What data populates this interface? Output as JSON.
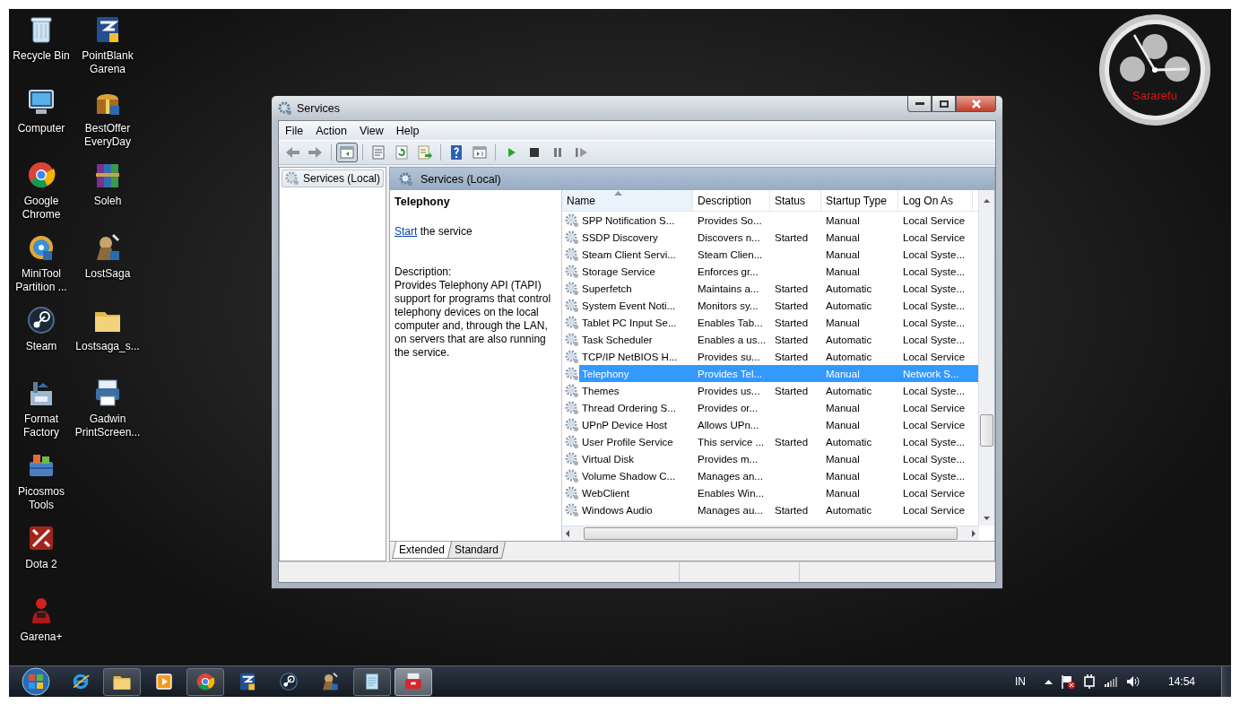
{
  "desktop": {
    "icon_columns": [
      {
        "icons": [
          {
            "label": "Recycle Bin",
            "kind": "bin"
          },
          {
            "label": "Computer",
            "kind": "computer"
          },
          {
            "label": "Google Chrome",
            "kind": "chrome"
          },
          {
            "label": "MiniTool Partition ...",
            "kind": "disk"
          },
          {
            "label": "Steam",
            "kind": "steam"
          },
          {
            "label": "Format Factory",
            "kind": "factory"
          },
          {
            "label": "Picosmos Tools",
            "kind": "tools"
          },
          {
            "label": "Dota 2",
            "kind": "dota"
          },
          {
            "label": "Garena+",
            "kind": "garena"
          }
        ]
      },
      {
        "icons": [
          {
            "label": "PointBlank Garena",
            "kind": "game"
          },
          {
            "label": "BestOffer EveryDay",
            "kind": "gift"
          },
          {
            "label": "Soleh",
            "kind": "archive"
          },
          {
            "label": "LostSaga",
            "kind": "warrior"
          },
          {
            "label": "Lostsaga_s...",
            "kind": "folder"
          },
          {
            "label": "Gadwin PrintScreen...",
            "kind": "camera"
          }
        ]
      }
    ]
  },
  "clock_gadget": {
    "label": "Sararefu"
  },
  "window": {
    "title": "Services",
    "menu": [
      "File",
      "Action",
      "View",
      "Help"
    ],
    "toolbar": [
      {
        "kind": "back",
        "pressed": false
      },
      {
        "kind": "forward",
        "pressed": false
      },
      {
        "kind": "tree",
        "pressed": true
      },
      {
        "kind": "properties",
        "pressed": false
      },
      {
        "kind": "refresh",
        "pressed": false
      },
      {
        "kind": "export",
        "pressed": false
      },
      {
        "kind": "help",
        "pressed": false
      },
      {
        "kind": "view",
        "pressed": false
      },
      {
        "kind": "play",
        "pressed": false
      },
      {
        "kind": "stop",
        "pressed": false
      },
      {
        "kind": "pause",
        "pressed": false
      },
      {
        "kind": "resume",
        "pressed": false
      }
    ],
    "tree": [
      {
        "label": "Services (Local)",
        "selected": true
      }
    ],
    "header": "Services (Local)",
    "details": {
      "title": "Telephony",
      "action_link": "Start",
      "action_text": "the service",
      "description_label": "Description:",
      "description": "Provides Telephony API (TAPI) support for programs that control telephony devices on the local computer and, through the LAN, on servers that are also running the service."
    },
    "table": {
      "columns": [
        {
          "label": "Name",
          "sorted": true
        },
        {
          "label": "Description",
          "sorted": false
        },
        {
          "label": "Status",
          "sorted": false
        },
        {
          "label": "Startup Type",
          "sorted": false
        },
        {
          "label": "Log On As",
          "sorted": false
        }
      ],
      "rows": [
        {
          "cells": [
            "SPP Notification S...",
            "Provides So...",
            "",
            "Manual",
            "Local Service"
          ],
          "selected": false
        },
        {
          "cells": [
            "SSDP Discovery",
            "Discovers n...",
            "Started",
            "Manual",
            "Local Service"
          ],
          "selected": false
        },
        {
          "cells": [
            "Steam Client Servi...",
            "Steam Clien...",
            "",
            "Manual",
            "Local Syste..."
          ],
          "selected": false
        },
        {
          "cells": [
            "Storage Service",
            "Enforces gr...",
            "",
            "Manual",
            "Local Syste..."
          ],
          "selected": false
        },
        {
          "cells": [
            "Superfetch",
            "Maintains a...",
            "Started",
            "Automatic",
            "Local Syste..."
          ],
          "selected": false
        },
        {
          "cells": [
            "System Event Noti...",
            "Monitors sy...",
            "Started",
            "Automatic",
            "Local Syste..."
          ],
          "selected": false
        },
        {
          "cells": [
            "Tablet PC Input Se...",
            "Enables Tab...",
            "Started",
            "Manual",
            "Local Syste..."
          ],
          "selected": false
        },
        {
          "cells": [
            "Task Scheduler",
            "Enables a us...",
            "Started",
            "Automatic",
            "Local Syste..."
          ],
          "selected": false
        },
        {
          "cells": [
            "TCP/IP NetBIOS H...",
            "Provides su...",
            "Started",
            "Automatic",
            "Local Service"
          ],
          "selected": false
        },
        {
          "cells": [
            "Telephony",
            "Provides Tel...",
            "",
            "Manual",
            "Network S..."
          ],
          "selected": true
        },
        {
          "cells": [
            "Themes",
            "Provides us...",
            "Started",
            "Automatic",
            "Local Syste..."
          ],
          "selected": false
        },
        {
          "cells": [
            "Thread Ordering S...",
            "Provides or...",
            "",
            "Manual",
            "Local Service"
          ],
          "selected": false
        },
        {
          "cells": [
            "UPnP Device Host",
            "Allows UPn...",
            "",
            "Manual",
            "Local Service"
          ],
          "selected": false
        },
        {
          "cells": [
            "User Profile Service",
            "This service ...",
            "Started",
            "Automatic",
            "Local Syste..."
          ],
          "selected": false
        },
        {
          "cells": [
            "Virtual Disk",
            "Provides m...",
            "",
            "Manual",
            "Local Syste..."
          ],
          "selected": false
        },
        {
          "cells": [
            "Volume Shadow C...",
            "Manages an...",
            "",
            "Manual",
            "Local Syste..."
          ],
          "selected": false
        },
        {
          "cells": [
            "WebClient",
            "Enables Win...",
            "",
            "Manual",
            "Local Service"
          ],
          "selected": false
        },
        {
          "cells": [
            "Windows Audio",
            "Manages au...",
            "Started",
            "Automatic",
            "Local Service"
          ],
          "selected": false
        }
      ]
    },
    "tabs": [
      {
        "label": "Extended",
        "selected": true
      },
      {
        "label": "Standard",
        "selected": false
      }
    ]
  },
  "taskbar": {
    "apps": [
      {
        "kind": "ie",
        "running": false,
        "selected": false
      },
      {
        "kind": "folder",
        "running": true,
        "selected": false
      },
      {
        "kind": "player",
        "running": false,
        "selected": false
      },
      {
        "kind": "chrome",
        "running": true,
        "selected": false
      },
      {
        "kind": "game",
        "running": false,
        "selected": false
      },
      {
        "kind": "steam",
        "running": false,
        "selected": false
      },
      {
        "kind": "warrior",
        "running": false,
        "selected": false
      },
      {
        "kind": "notepad",
        "running": true,
        "selected": false
      },
      {
        "kind": "toolbox",
        "running": true,
        "selected": true
      }
    ],
    "language": "IN",
    "time": "14:54"
  }
}
